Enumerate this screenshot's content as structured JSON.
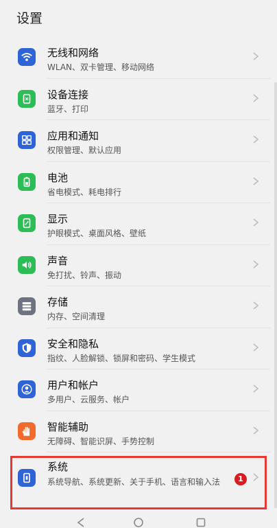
{
  "header": {
    "title": "设置"
  },
  "settings": [
    {
      "label": "无线和网络",
      "sub": "WLAN、双卡管理、移动网络",
      "icon": "wifi-icon",
      "color": "#2f64d6"
    },
    {
      "label": "设备连接",
      "sub": "蓝牙、打印",
      "icon": "device-connect-icon",
      "color": "#2dbd56"
    },
    {
      "label": "应用和通知",
      "sub": "权限管理、默认应用",
      "icon": "apps-icon",
      "color": "#2f64d6"
    },
    {
      "label": "电池",
      "sub": "省电模式、耗电排行",
      "icon": "battery-icon",
      "color": "#2dbd56"
    },
    {
      "label": "显示",
      "sub": "护眼模式、桌面风格、壁纸",
      "icon": "display-icon",
      "color": "#2dbd56"
    },
    {
      "label": "声音",
      "sub": "免打扰、铃声、振动",
      "icon": "sound-icon",
      "color": "#2dbd56"
    },
    {
      "label": "存储",
      "sub": "内存、空间清理",
      "icon": "storage-icon",
      "color": "#6d7480"
    },
    {
      "label": "安全和隐私",
      "sub": "指纹、人脸解锁、锁屏和密码、学生模式",
      "icon": "shield-icon",
      "color": "#2f64d6"
    },
    {
      "label": "用户和帐户",
      "sub": "多用户、云服务、帐户",
      "icon": "user-icon",
      "color": "#2f64d6"
    },
    {
      "label": "智能辅助",
      "sub": "无障碍、智能识屏、手势控制",
      "icon": "hand-icon",
      "color": "#f26a2c"
    },
    {
      "label": "系统",
      "sub": "系统导航、系统更新、关于手机、语言和输入法",
      "icon": "phone-icon",
      "color": "#2f64d6",
      "badge": "1"
    }
  ],
  "badge_color": "#d71d22",
  "highlight_color": "#e53935"
}
